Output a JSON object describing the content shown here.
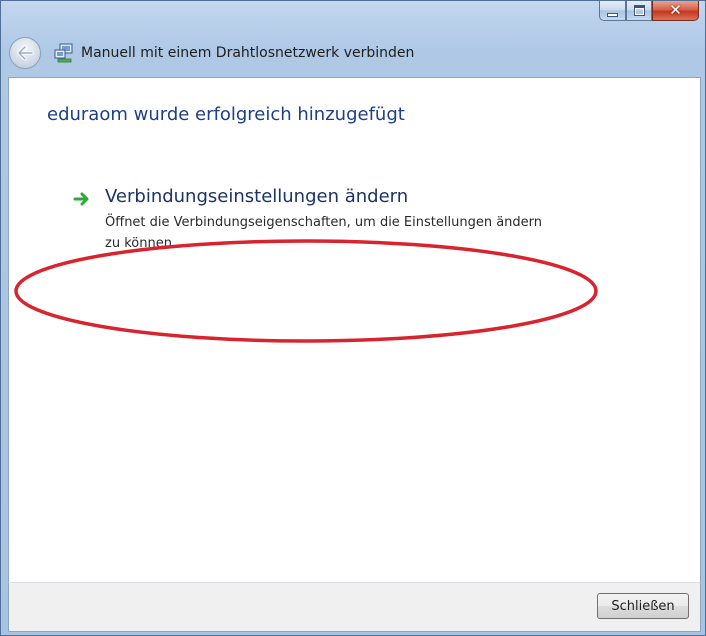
{
  "window": {
    "title": "Manuell mit einem Drahtlosnetzwerk verbinden",
    "caption": {
      "minimize_icon": "minimize-icon",
      "maximize_icon": "maximize-icon",
      "close_glyph": "✕"
    }
  },
  "main": {
    "instruction": "eduraom wurde erfolgreich hinzugefügt",
    "command_link": {
      "title": "Verbindungseinstellungen ändern",
      "description": "Öffnet die Verbindungseigenschaften, um die Einstellungen ändern zu können.",
      "icon": "green-arrow-icon"
    },
    "highlight_color": "#d8242e"
  },
  "footer": {
    "close_label": "Schließen"
  },
  "colors": {
    "instruction": "#1d3f8a",
    "link_title": "#1d3266",
    "close_button_red": "#c4371f"
  }
}
